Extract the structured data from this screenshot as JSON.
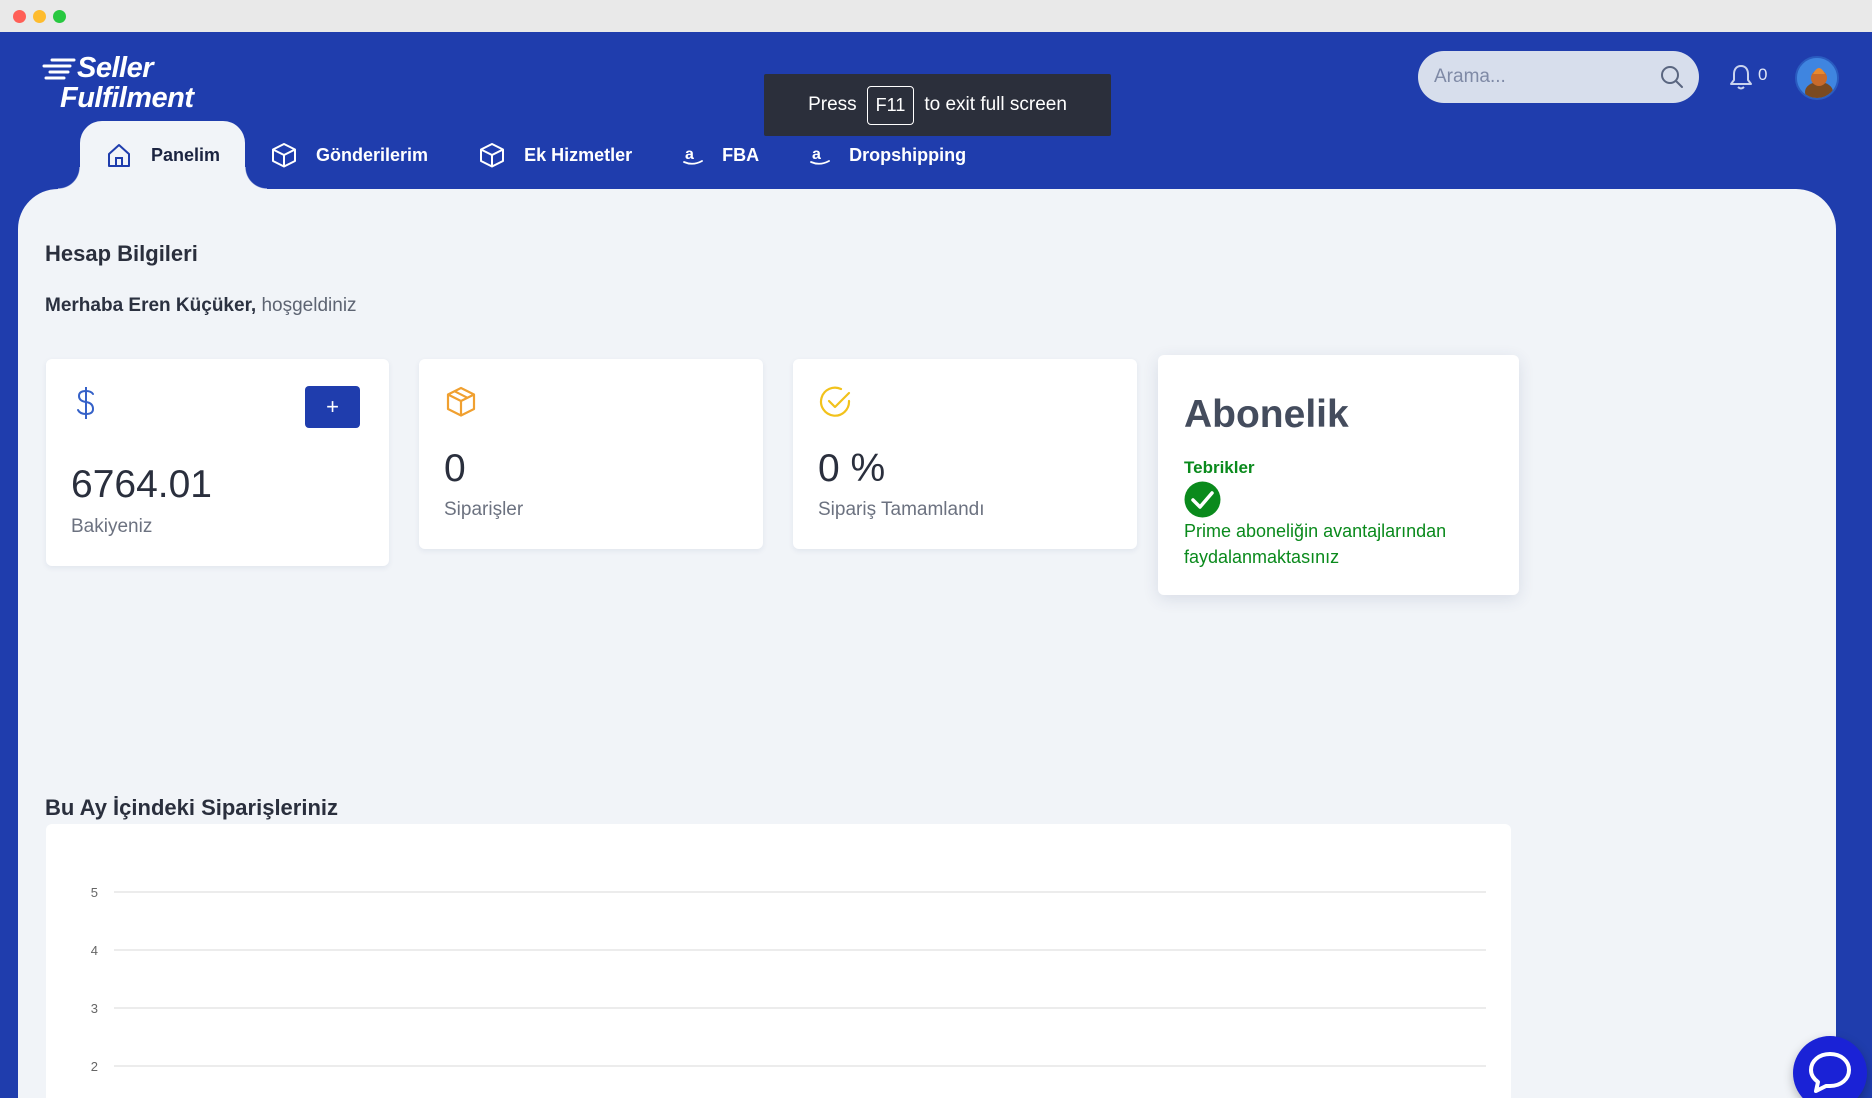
{
  "brand": {
    "line1": "Seller",
    "line2": "Fulfilment"
  },
  "fullscreen_banner": {
    "press": "Press",
    "key": "F11",
    "suffix": "to exit full screen"
  },
  "search": {
    "placeholder": "Arama..."
  },
  "notifications": {
    "count": "0"
  },
  "nav": {
    "tabs": [
      {
        "label": "Panelim",
        "icon": "home-icon",
        "active": true
      },
      {
        "label": "Gönderilerim",
        "icon": "box-icon"
      },
      {
        "label": "Ek Hizmetler",
        "icon": "box-icon"
      },
      {
        "label": "FBA",
        "icon": "amazon-icon"
      },
      {
        "label": "Dropshipping",
        "icon": "amazon-icon"
      }
    ]
  },
  "account": {
    "title": "Hesap Bilgileri",
    "greeting_name": "Merhaba Eren Küçüker,",
    "greeting_suffix": "hoşgeldiniz"
  },
  "cards": {
    "balance": {
      "value": "6764.01",
      "label": "Bakiyeniz",
      "add_label": "+"
    },
    "orders": {
      "value": "0",
      "label": "Siparişler"
    },
    "completed": {
      "value": "0 %",
      "label": "Sipariş Tamamlandı"
    }
  },
  "subscription": {
    "title": "Abonelik",
    "status": "Tebrikler",
    "message": "Prime aboneliğin avantajlarından faydalanmaktasınız"
  },
  "monthly_orders": {
    "title": "Bu Ay İçindeki Siparişleriniz"
  },
  "chart_data": {
    "type": "line",
    "y_ticks": [
      "5",
      "4",
      "3",
      "2"
    ],
    "grid": true,
    "colors": {
      "grid": "#e6e6e6",
      "tick": "#666666"
    }
  },
  "colors": {
    "primary": "#1f3dad",
    "panel": "#f1f4f8",
    "success": "#0a8a1c",
    "orange": "#f0a030",
    "yellow": "#f2c21b",
    "chat": "#1a22d6"
  }
}
